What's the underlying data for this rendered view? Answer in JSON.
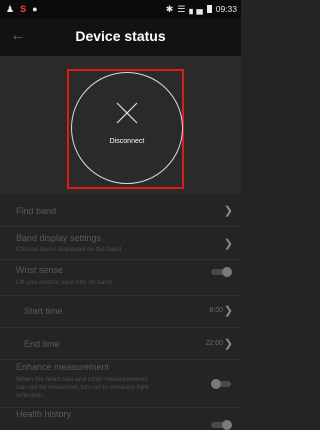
{
  "status_bar": {
    "time": "09:33",
    "left_icons": [
      "person-icon",
      "s-icon",
      "paw-icon"
    ],
    "right_icons": [
      "bluetooth-icon",
      "vibrate-icon",
      "signal-icon",
      "battery-icon"
    ]
  },
  "header": {
    "title": "Device status",
    "back_icon": "arrow-left-icon"
  },
  "hero": {
    "disconnect_label": "Disconnect",
    "icon": "close-icon"
  },
  "settings": {
    "find_band": {
      "label": "Find band"
    },
    "band_display": {
      "label": "Band display settings",
      "subtitle": "Choose items displayed on the band"
    },
    "wrist_sense": {
      "label": "Wrist sense",
      "subtitle": "Lift you wrist to view info on band",
      "toggle_on": true
    },
    "start_time": {
      "label": "Start time",
      "value": "8:00"
    },
    "end_time": {
      "label": "End time",
      "value": "22:00"
    },
    "enhance_measurement": {
      "label": "Enhance measurement",
      "subtitle_line1": "When the heart rate and other measurements",
      "subtitle_line2": "can not be measured, turn on to enhance light",
      "subtitle_line3": "reflection.",
      "toggle_on": false
    },
    "health_history": {
      "label": "Health history"
    }
  },
  "colors": {
    "accent": "#3d6cc7",
    "highlight_frame": "#e01a1a",
    "background": "#242424"
  }
}
